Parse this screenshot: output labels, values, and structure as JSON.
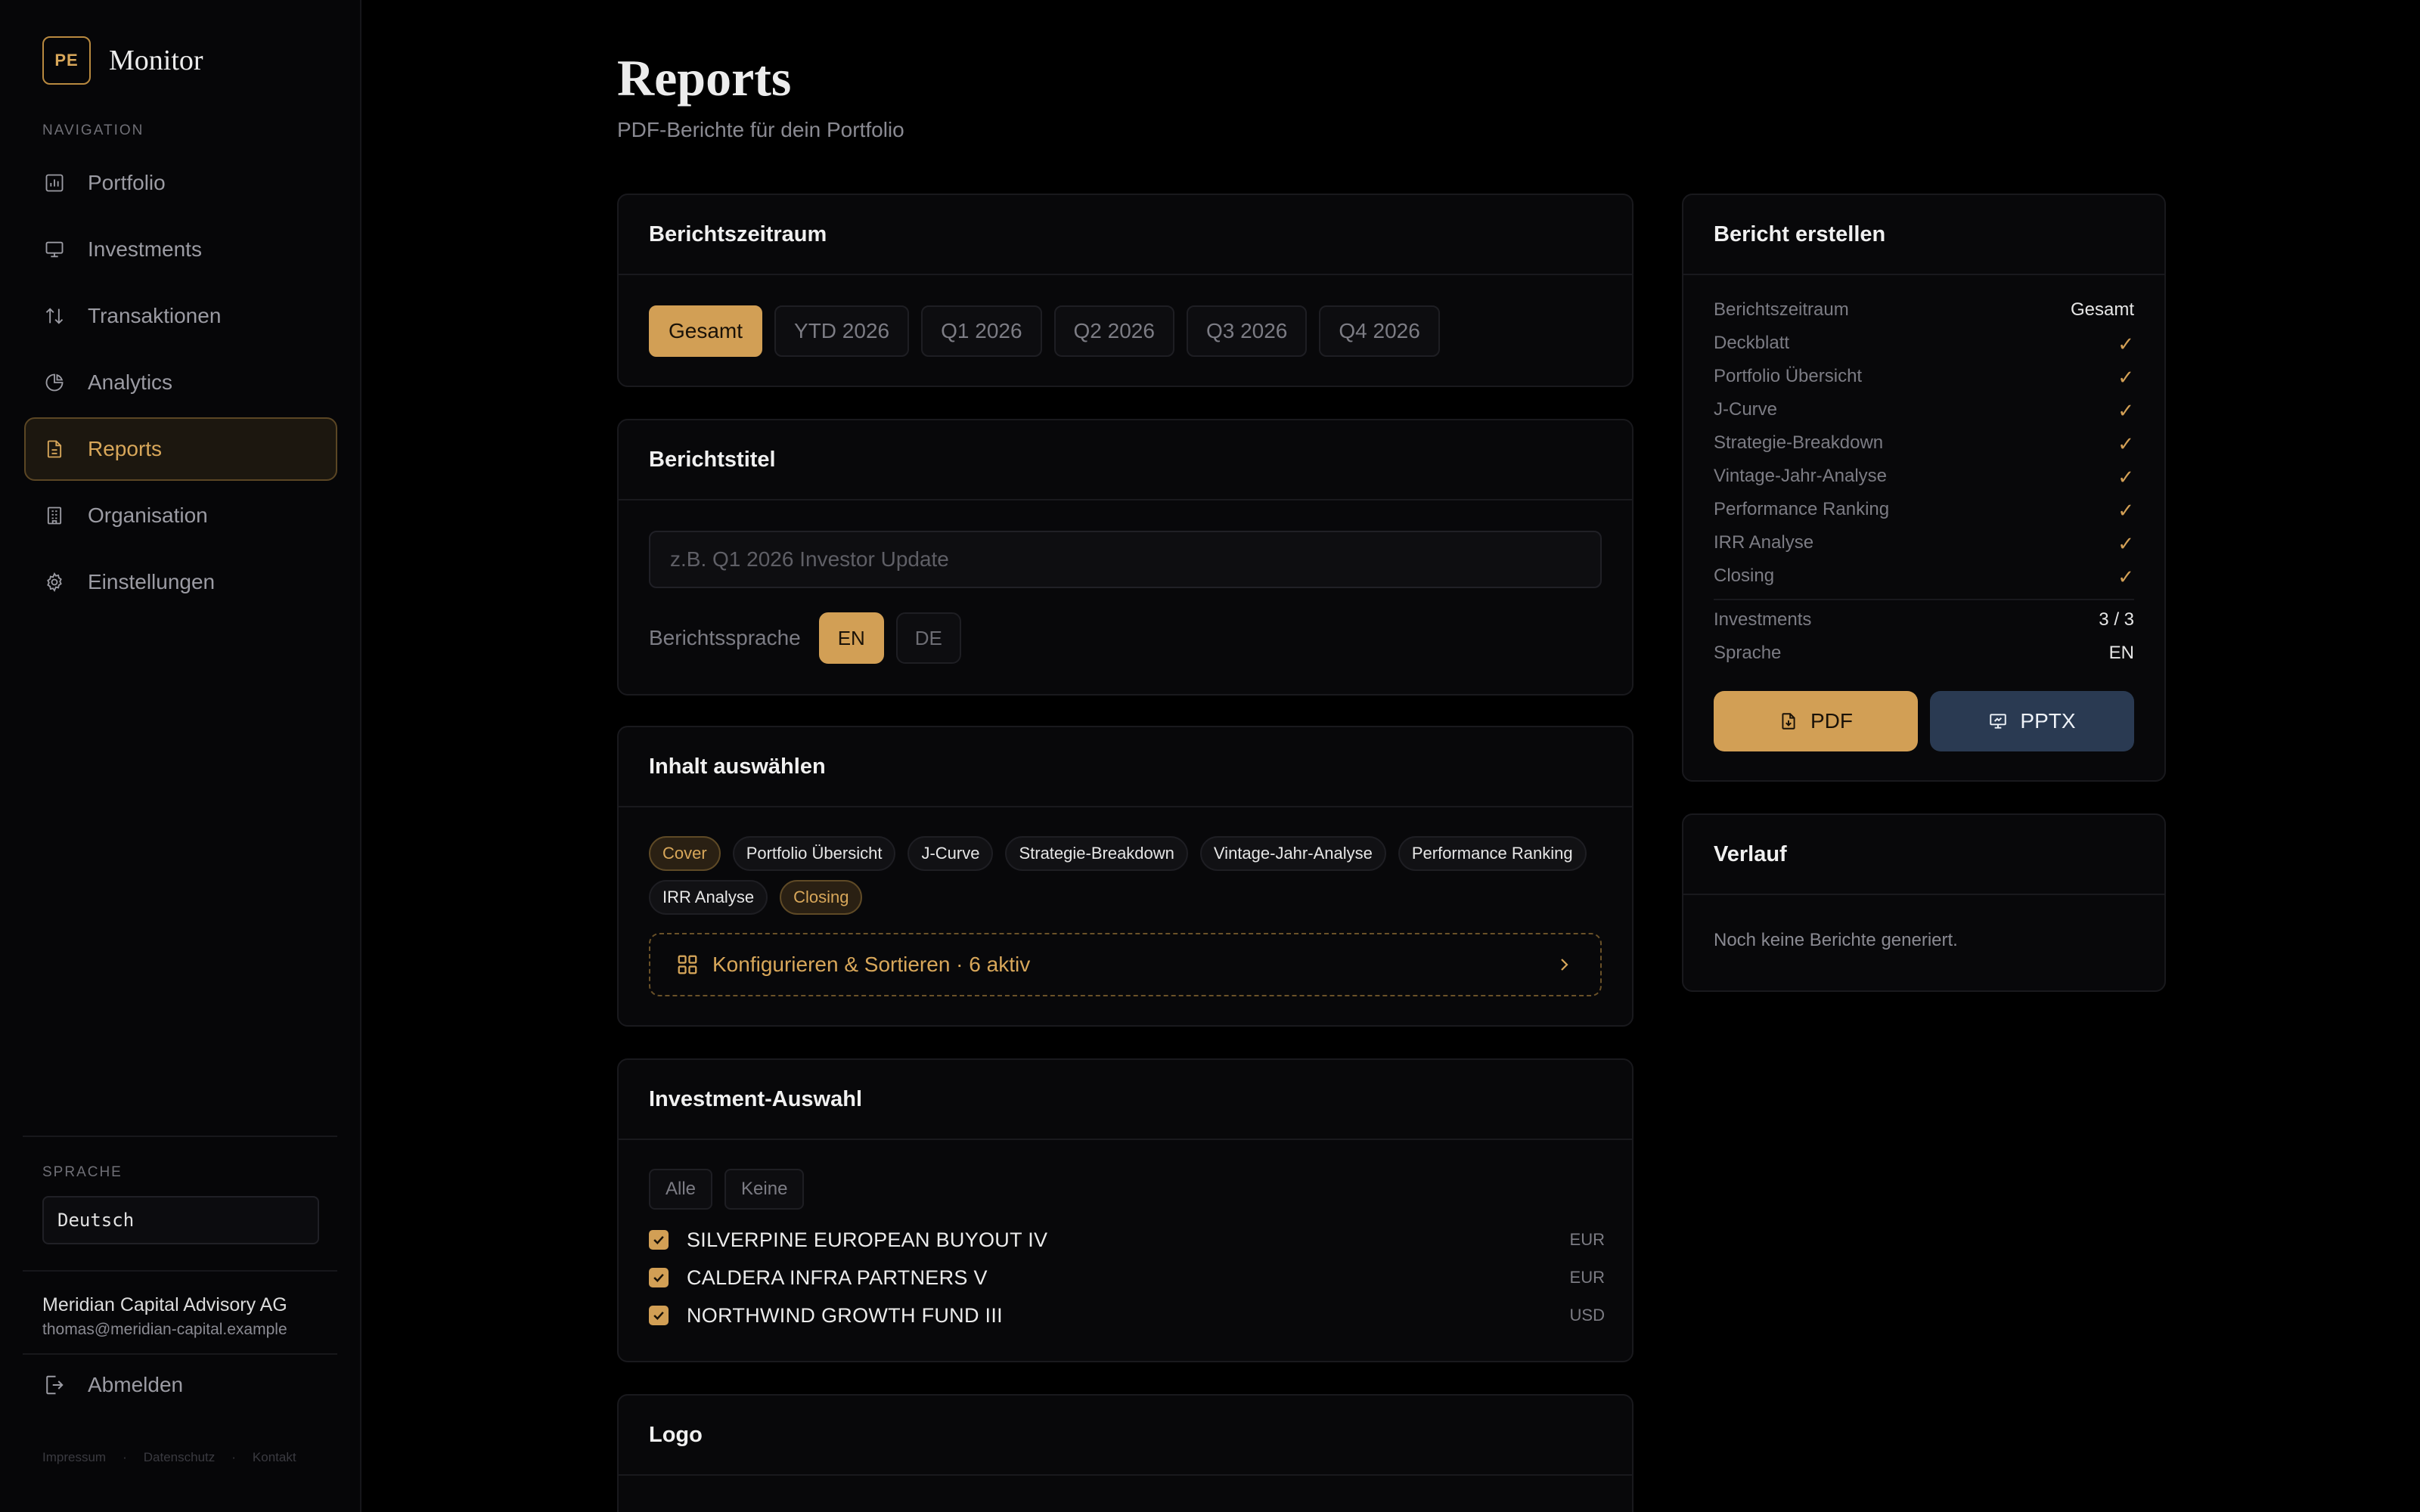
{
  "brand": {
    "logo": "PE",
    "name": "Monitor"
  },
  "sidebar": {
    "section_label": "NAVIGATION",
    "items": [
      {
        "label": "Portfolio",
        "icon": "bar-chart-icon",
        "active": false
      },
      {
        "label": "Investments",
        "icon": "monitor-icon",
        "active": false
      },
      {
        "label": "Transaktionen",
        "icon": "arrows-updown-icon",
        "active": false
      },
      {
        "label": "Analytics",
        "icon": "pie-chart-icon",
        "active": false
      },
      {
        "label": "Reports",
        "icon": "document-icon",
        "active": true
      },
      {
        "label": "Organisation",
        "icon": "building-icon",
        "active": false
      },
      {
        "label": "Einstellungen",
        "icon": "gear-icon",
        "active": false
      }
    ],
    "language_label": "SPRACHE",
    "language_value": "Deutsch",
    "org_name": "Meridian Capital Advisory AG",
    "org_email": "thomas@meridian-capital.example",
    "logout_label": "Abmelden",
    "footer_links": [
      "Impressum",
      "·",
      "Datenschutz",
      "·",
      "Kontakt"
    ]
  },
  "page": {
    "title": "Reports",
    "subtitle": "PDF-Berichte für dein Portfolio"
  },
  "period_card": {
    "title": "Berichtszeitraum",
    "options": [
      "Gesamt",
      "YTD 2026",
      "Q1 2026",
      "Q2 2026",
      "Q3 2026",
      "Q4 2026"
    ],
    "selected": "Gesamt"
  },
  "title_card": {
    "title": "Berichtstitel",
    "input_placeholder": "z.B. Q1 2026 Investor Update",
    "input_value": "",
    "language_label": "Berichtssprache",
    "languages": [
      "EN",
      "DE"
    ],
    "selected_language": "EN"
  },
  "content_card": {
    "title": "Inhalt auswählen",
    "chips": [
      {
        "label": "Cover",
        "highlight": true
      },
      {
        "label": "Portfolio Übersicht",
        "highlight": false
      },
      {
        "label": "J-Curve",
        "highlight": false
      },
      {
        "label": "Strategie-Breakdown",
        "highlight": false
      },
      {
        "label": "Vintage-Jahr-Analyse",
        "highlight": false
      },
      {
        "label": "Performance Ranking",
        "highlight": false
      },
      {
        "label": "IRR Analyse",
        "highlight": false
      },
      {
        "label": "Closing",
        "highlight": true
      }
    ],
    "config_label": "Konfigurieren & Sortieren · 6 aktiv"
  },
  "investment_card": {
    "title": "Investment-Auswahl",
    "all_label": "Alle",
    "none_label": "Keine",
    "investments": [
      {
        "name": "SILVERPINE EUROPEAN BUYOUT IV",
        "currency": "EUR",
        "checked": true
      },
      {
        "name": "CALDERA INFRA PARTNERS V",
        "currency": "EUR",
        "checked": true
      },
      {
        "name": "NORTHWIND GROWTH FUND III",
        "currency": "USD",
        "checked": true
      }
    ]
  },
  "logo_card": {
    "title": "Logo"
  },
  "summary_card": {
    "title": "Bericht erstellen",
    "period_label": "Berichtszeitraum",
    "period_value": "Gesamt",
    "sections": [
      {
        "label": "Deckblatt",
        "value": "✓"
      },
      {
        "label": "Portfolio Übersicht",
        "value": "✓"
      },
      {
        "label": "J-Curve",
        "value": "✓"
      },
      {
        "label": "Strategie-Breakdown",
        "value": "✓"
      },
      {
        "label": "Vintage-Jahr-Analyse",
        "value": "✓"
      },
      {
        "label": "Performance Ranking",
        "value": "✓"
      },
      {
        "label": "IRR Analyse",
        "value": "✓"
      },
      {
        "label": "Closing",
        "value": "✓"
      }
    ],
    "investments_label": "Investments",
    "investments_value": "3 / 3",
    "language_label": "Sprache",
    "language_value": "EN",
    "pdf_label": "PDF",
    "pptx_label": "PPTX"
  },
  "history_card": {
    "title": "Verlauf",
    "empty_text": "Noch keine Berichte generiert."
  },
  "colors": {
    "accent": "#d29f55",
    "pptx_button": "#2a3a52",
    "background": "#000000",
    "card": "#08080a"
  }
}
